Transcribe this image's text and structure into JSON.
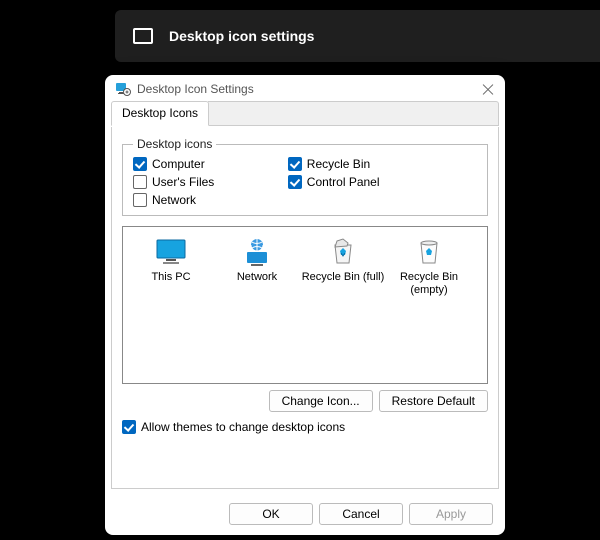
{
  "banner": {
    "title": "Desktop icon settings"
  },
  "dialog": {
    "title": "Desktop Icon Settings",
    "tab_label": "Desktop Icons",
    "group_legend": "Desktop icons",
    "checkboxes": {
      "computer": {
        "label": "Computer",
        "checked": true
      },
      "users_files": {
        "label": "User's Files",
        "checked": false
      },
      "network": {
        "label": "Network",
        "checked": false
      },
      "recycle_bin": {
        "label": "Recycle Bin",
        "checked": true
      },
      "control_panel": {
        "label": "Control Panel",
        "checked": true
      }
    },
    "preview_icons": {
      "this_pc": "This PC",
      "network": "Network",
      "rb_full": "Recycle Bin (full)",
      "rb_empty": "Recycle Bin (empty)"
    },
    "buttons": {
      "change_icon": "Change Icon...",
      "restore_default": "Restore Default",
      "ok": "OK",
      "cancel": "Cancel",
      "apply": "Apply"
    },
    "allow_themes": {
      "label": "Allow themes to change desktop icons",
      "checked": true
    }
  }
}
